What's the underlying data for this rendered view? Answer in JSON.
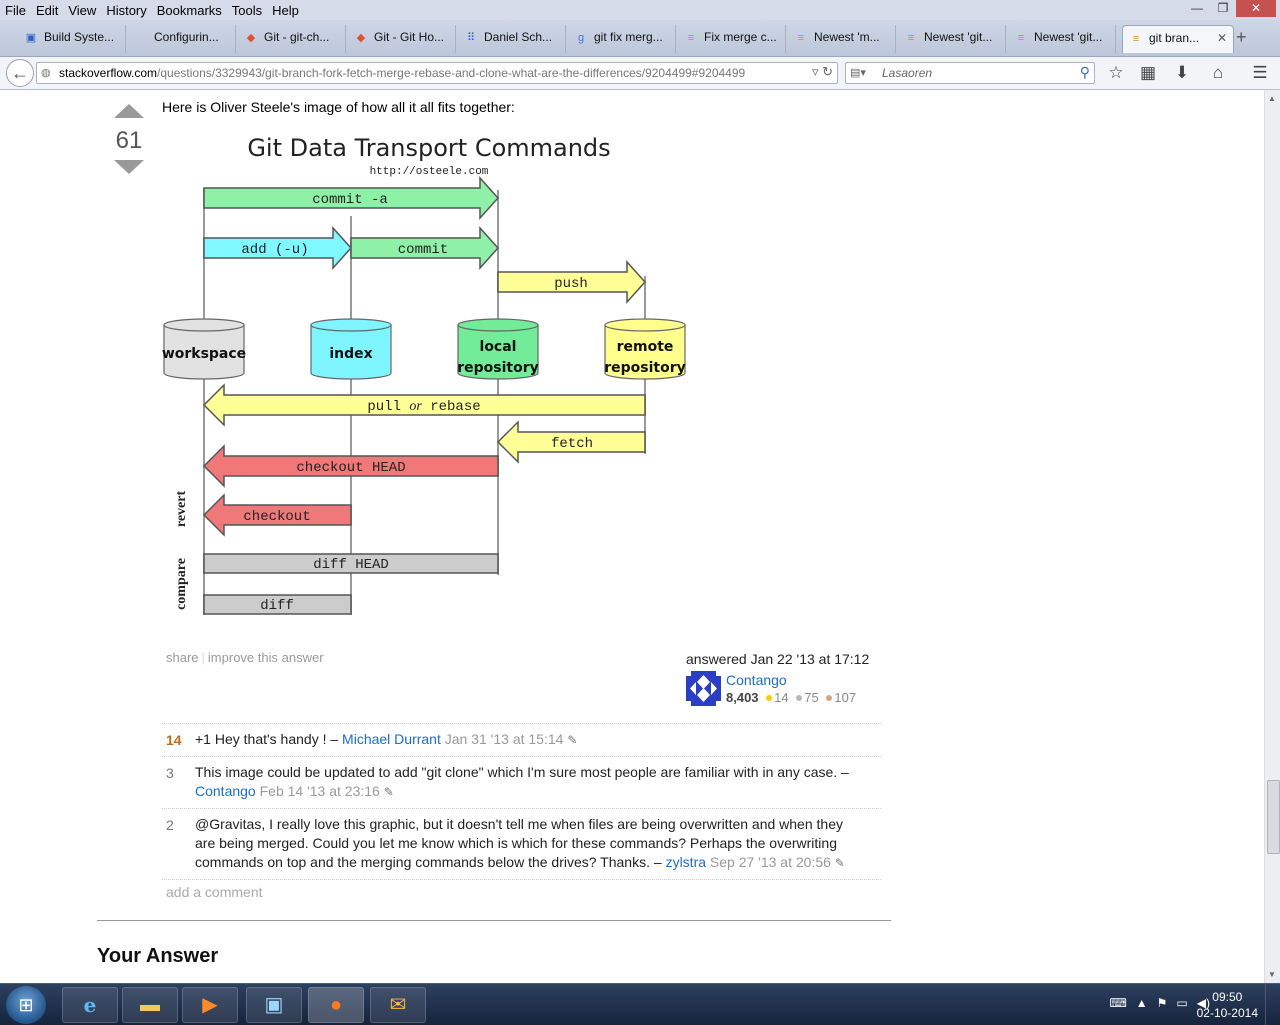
{
  "browser": {
    "menu": [
      "File",
      "Edit",
      "View",
      "History",
      "Bookmarks",
      "Tools",
      "Help"
    ],
    "window_controls": {
      "minimize": "—",
      "maximize": "❐",
      "close": "✕"
    },
    "tabs": [
      {
        "label": "Build Syste...",
        "icon": "page-icon",
        "glyph": "▣",
        "color": "#2a62c9"
      },
      {
        "label": "Configurin...",
        "icon": "blank-page-icon",
        "glyph": "",
        "color": "#888"
      },
      {
        "label": "Git - git-ch...",
        "icon": "git-logo-icon",
        "glyph": "◆",
        "color": "#e2512f"
      },
      {
        "label": "Git - Git Ho...",
        "icon": "git-logo-icon",
        "glyph": "◆",
        "color": "#e2512f"
      },
      {
        "label": "Daniel Sch...",
        "icon": "trello-icon",
        "glyph": "⠿",
        "color": "#2a62c9"
      },
      {
        "label": "git fix merg...",
        "icon": "google-icon",
        "glyph": "g",
        "color": "#3a79d8"
      },
      {
        "label": "Fix merge c...",
        "icon": "stackoverflow-icon",
        "glyph": "≡",
        "color": "#e28a2a"
      },
      {
        "label": "Newest 'm...",
        "icon": "stackoverflow-icon",
        "glyph": "≡",
        "color": "#e28a2a"
      },
      {
        "label": "Newest 'git...",
        "icon": "stackoverflow-icon",
        "glyph": "≡",
        "color": "#e28a2a"
      },
      {
        "label": "Newest 'git...",
        "icon": "stackoverflow-icon",
        "glyph": "≡",
        "color": "#e28a2a"
      },
      {
        "label": "git bran...",
        "icon": "stackoverflow-icon",
        "glyph": "≡",
        "color": "#e28a2a",
        "active": true
      }
    ],
    "new_tab": "+",
    "url_host": "stackoverflow.com",
    "url_path": "/questions/3329943/git-branch-fork-fetch-merge-rebase-and-clone-what-are-the-differences/9204499#9204499",
    "search_placeholder": "Lasaoren"
  },
  "answer": {
    "votes": "61",
    "intro": "Here is Oliver Steele's image of how all it all fits together:",
    "menu": {
      "share": "share",
      "improve": "improve this answer"
    },
    "signature": {
      "action": "answered Jan 22 '13 at 17:12",
      "user": "Contango",
      "reputation": "8,403",
      "gold": "14",
      "silver": "75",
      "bronze": "107"
    }
  },
  "diagram": {
    "title": "Git Data Transport Commands",
    "subtitle": "http://osteele.com",
    "stores": [
      {
        "line1": "workspace",
        "line2": "",
        "color": "#e2e2e2"
      },
      {
        "line1": "index",
        "line2": "",
        "color": "#7ff5ff"
      },
      {
        "line1": "local",
        "line2": "repository",
        "color": "#72ec98"
      },
      {
        "line1": "remote",
        "line2": "repository",
        "color": "#ffff8c"
      }
    ],
    "arrows": {
      "commit_a": "commit -a",
      "add": "add (-u)",
      "commit": "commit",
      "push": "push",
      "pull_1": "pull ",
      "pull_or": "or",
      "pull_2": " rebase",
      "fetch": "fetch",
      "checkout_head": "checkout HEAD",
      "checkout": "checkout",
      "diff_head": "diff HEAD",
      "diff": "diff"
    },
    "groups": {
      "revert": "revert",
      "compare": "compare"
    }
  },
  "comments": [
    {
      "score": "14",
      "text": "+1 Hey that's handy ! – ",
      "user": "Michael Durrant",
      "date": "Jan 31 '13 at 15:14"
    },
    {
      "score": "3",
      "text": "This image could be updated to add \"git clone\" which I'm sure most people are familiar with in any case. – ",
      "user": "Contango",
      "date": "Feb 14 '13 at 23:16"
    },
    {
      "score": "2",
      "text": "@Gravitas, I really love this graphic, but it doesn't tell me when files are being overwritten and when they are being merged. Could you let me know which is which for these commands? Perhaps the overwriting commands on top and the merging commands below the drives? Thanks. – ",
      "user": "zylstra",
      "date": "Sep 27 '13 at 20:56"
    }
  ],
  "add_comment": "add a comment",
  "your_answer": "Your Answer",
  "taskbar": {
    "time": "09:50",
    "date": "02-10-2014"
  }
}
